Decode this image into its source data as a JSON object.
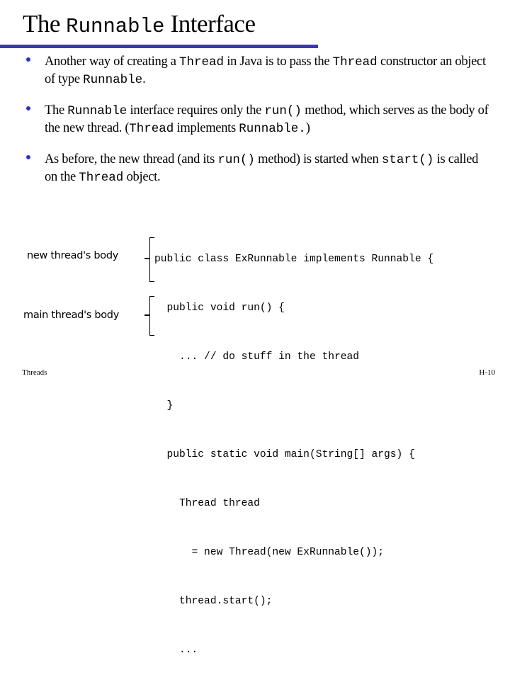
{
  "slide": {
    "title": {
      "prefix": "The ",
      "code": "Runnable",
      "suffix": " Interface"
    },
    "accent_color": "#3a3aab",
    "bullet_color": "#3232b8",
    "bullets": [
      {
        "parts": [
          {
            "t": "Another way of creating a "
          },
          {
            "c": "Thread"
          },
          {
            "t": " in Java is to pass the "
          },
          {
            "c": "Thread"
          },
          {
            "t": " constructor an object of type "
          },
          {
            "c": "Runnable"
          },
          {
            "t": "."
          }
        ]
      },
      {
        "parts": [
          {
            "t": "The "
          },
          {
            "c": "Runnable"
          },
          {
            "t": " interface requires only the "
          },
          {
            "c": "run()"
          },
          {
            "t": " method, which serves as the body of the new thread. ("
          },
          {
            "c": "Thread"
          },
          {
            "t": " implements "
          },
          {
            "c": "Runnable."
          },
          {
            "t": ")"
          }
        ]
      },
      {
        "parts": [
          {
            "t": "As before, the new thread (and its "
          },
          {
            "c": "run()"
          },
          {
            "t": " method) is started when "
          },
          {
            "c": "start()"
          },
          {
            "t": " is called on the "
          },
          {
            "c": "Thread"
          },
          {
            "t": " object."
          }
        ]
      }
    ],
    "labels": {
      "new_thread": "new thread's body",
      "main_thread": "main thread's body"
    },
    "code_lines": [
      "public class ExRunnable implements Runnable {",
      "  public void run() {",
      "    ... // do stuff in the thread",
      "  }",
      "  public static void main(String[] args) {",
      "    Thread thread",
      "      = new Thread(new ExRunnable());",
      "    thread.start();",
      "    ..."
    ],
    "footer": {
      "left": "Threads",
      "right": "H-10"
    }
  }
}
